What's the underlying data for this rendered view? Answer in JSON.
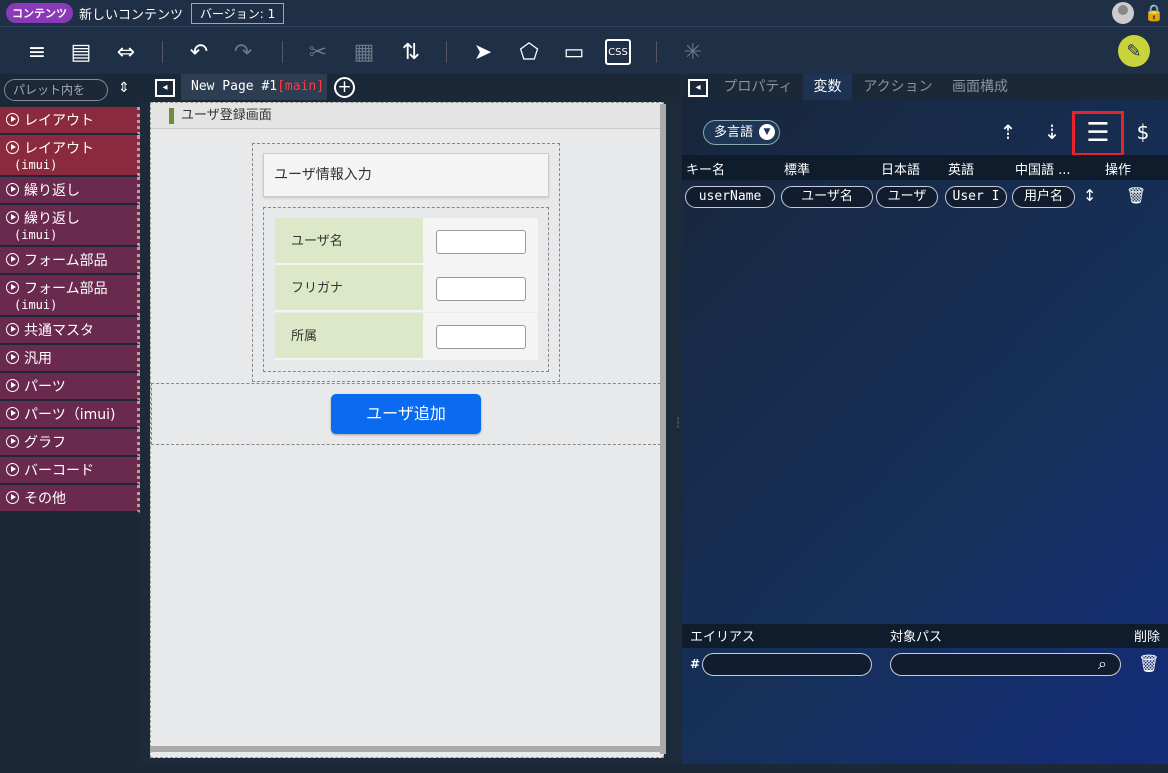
{
  "header": {
    "content_tag": "コンテンツ",
    "content_name": "新しいコンテンツ",
    "version": "バージョン: 1"
  },
  "palette": {
    "search_placeholder": "パレット内を",
    "items": [
      {
        "label": "レイアウト",
        "sub": ""
      },
      {
        "label": "レイアウト",
        "sub": "(imui)"
      },
      {
        "label": "繰り返し",
        "sub": ""
      },
      {
        "label": "繰り返し",
        "sub": "(imui)"
      },
      {
        "label": "フォーム部品",
        "sub": ""
      },
      {
        "label": "フォーム部品",
        "sub": "(imui)"
      },
      {
        "label": "共通マスタ",
        "sub": ""
      },
      {
        "label": "汎用",
        "sub": ""
      },
      {
        "label": "パーツ",
        "sub": ""
      },
      {
        "label": "パーツ（imui)",
        "sub": ""
      },
      {
        "label": "グラフ",
        "sub": ""
      },
      {
        "label": "バーコード",
        "sub": ""
      },
      {
        "label": "その他",
        "sub": ""
      }
    ]
  },
  "canvas": {
    "tab_name": "New Page #1",
    "tab_branch": "[main]",
    "screen_title": "ユーザ登録画面",
    "card_title": "ユーザ情報入力",
    "fields": [
      "ユーザ名",
      "フリガナ",
      "所属"
    ],
    "add_button": "ユーザ追加"
  },
  "right": {
    "tabs": [
      "プロパティ",
      "変数",
      "アクション",
      "画面構成"
    ],
    "active_tab": "変数",
    "multilang": "多言語",
    "columns": [
      "キー名",
      "標準",
      "日本語",
      "英語",
      "中国語 ...",
      "操作"
    ],
    "row": {
      "key": "userName",
      "standard": "ユーザ名",
      "japanese": "ユーザ",
      "english": "User I",
      "chinese": "用户名"
    },
    "bottom_columns": [
      "エイリアス",
      "対象パス",
      "削除"
    ],
    "hash": "#"
  }
}
